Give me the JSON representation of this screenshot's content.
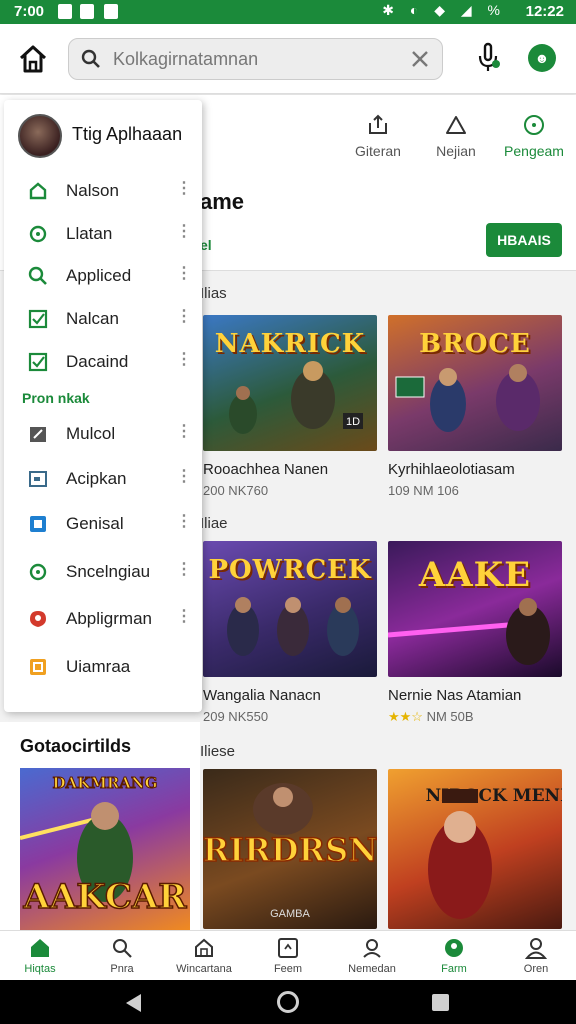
{
  "status_bar": {
    "time": "7:00",
    "clock_right": "12:22",
    "icons": [
      "notification-icon",
      "notification-icon",
      "notification-icon"
    ],
    "right_icons": "✱ ◐ ◆ ◢ %"
  },
  "topbar": {
    "search_placeholder": "Kolkagirnatamnan",
    "icons": [
      "home-icon",
      "search-icon",
      "close-icon",
      "mic-icon",
      "profile-icon"
    ],
    "avatar_glyph": "☻"
  },
  "tabs": [
    {
      "label": "Giteran",
      "icon": "share-icon"
    },
    {
      "label": "Nejian",
      "icon": "triangle-icon"
    },
    {
      "label": "Pengeam",
      "icon": "circle-icon"
    }
  ],
  "game_header": {
    "title": "ame",
    "subtitle": "el",
    "button_label": "HBAAIS"
  },
  "sections": [
    {
      "label": "Ilias",
      "cards": [
        {
          "thumb_text": "NAKRICK",
          "title": "Rooachhea Nanen",
          "meta": "200 NK760",
          "badge": "1D"
        },
        {
          "thumb_text": "BROCE",
          "title": "Kyrhihlaeolotiasam",
          "meta": "109 NM 106",
          "badge": ""
        }
      ]
    },
    {
      "label": "Iliae",
      "cards": [
        {
          "thumb_text": "POWRCEK",
          "title": "Wangalia Nanacn",
          "meta": "209 NK550",
          "badge": ""
        },
        {
          "thumb_text": "AAKE",
          "title": "Nernie Nas Atamian",
          "meta": "NM 50B",
          "badge": "★★☆"
        }
      ]
    },
    {
      "label": "Iliese",
      "cards": [
        {
          "thumb_text": "RIRDRSN",
          "title": "",
          "meta": "",
          "badge": "GAMBA"
        },
        {
          "thumb_text": "NIBOCK MENION",
          "title": "",
          "meta": "",
          "badge": ""
        }
      ]
    }
  ],
  "drawer": {
    "profile_name": "Ttig Aplhaaan",
    "items": [
      {
        "label": "Nalson",
        "icon": "home-icon",
        "color": "#1b8a3a"
      },
      {
        "label": "Llatan",
        "icon": "refresh-icon",
        "color": "#1b8a3a"
      },
      {
        "label": "Appliced",
        "icon": "search-icon",
        "color": "#1b8a3a"
      },
      {
        "label": "Nalcan",
        "icon": "checkbox-icon",
        "color": "#1b8a3a"
      },
      {
        "label": "Dacaind",
        "icon": "checkbox-icon",
        "color": "#1b8a3a"
      }
    ],
    "section_label": "Pron nkak",
    "items2": [
      {
        "label": "Mulcol",
        "icon": "edit-icon",
        "color": "#555555"
      },
      {
        "label": "Acipkan",
        "icon": "window-icon",
        "color": "#3a6a8a"
      },
      {
        "label": "Genisal",
        "icon": "app-icon",
        "color": "#1e7fd0"
      },
      {
        "label": "Sncelngiau",
        "icon": "refresh-icon",
        "color": "#1b8a3a"
      },
      {
        "label": "Abpligrman",
        "icon": "shield-icon",
        "color": "#d33a2c"
      },
      {
        "label": "Uiamraa",
        "icon": "square-icon",
        "color": "#f0a020"
      }
    ]
  },
  "left_lower": {
    "title": "Gotaocirtilds",
    "card_text": "AAKCAR",
    "card_top": "DAKMRANG"
  },
  "bottom_nav": [
    {
      "label": "Hiqtas",
      "icon": "home-icon"
    },
    {
      "label": "Pnra",
      "icon": "search-icon"
    },
    {
      "label": "Wincartana",
      "icon": "store-icon"
    },
    {
      "label": "Feem",
      "icon": "frame-icon"
    },
    {
      "label": "Nemedan",
      "icon": "user-icon"
    },
    {
      "label": "Farm",
      "icon": "leaf-icon"
    },
    {
      "label": "Oren",
      "icon": "account-icon"
    }
  ],
  "colors": {
    "accent": "#1b8a3a"
  }
}
